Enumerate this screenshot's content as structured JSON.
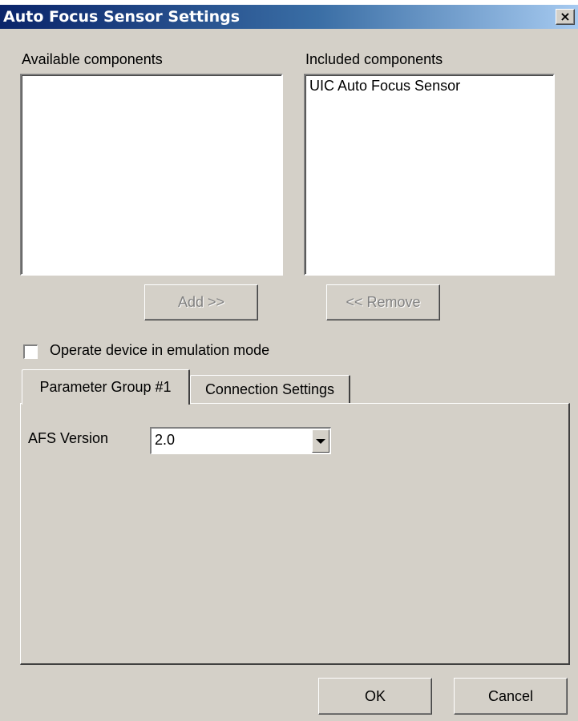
{
  "window": {
    "title": "Auto Focus Sensor Settings",
    "close_glyph": "×",
    "title_gradient_start": "#0a246a",
    "title_gradient_end": "#a6caf0",
    "face_color": "#d4d0c8"
  },
  "available": {
    "label": "Available components",
    "items": []
  },
  "included": {
    "label": "Included components",
    "items": [
      "UIC Auto Focus Sensor"
    ]
  },
  "buttons": {
    "add": "Add >>",
    "remove": "<< Remove",
    "ok": "OK",
    "cancel": "Cancel"
  },
  "emulation": {
    "label": "Operate device in emulation mode",
    "checked": false
  },
  "tabs": [
    {
      "label": "Parameter Group #1",
      "active": true
    },
    {
      "label": "Connection Settings",
      "active": false
    }
  ],
  "params": {
    "afs_version_label": "AFS Version",
    "afs_version_value": "2.0"
  }
}
